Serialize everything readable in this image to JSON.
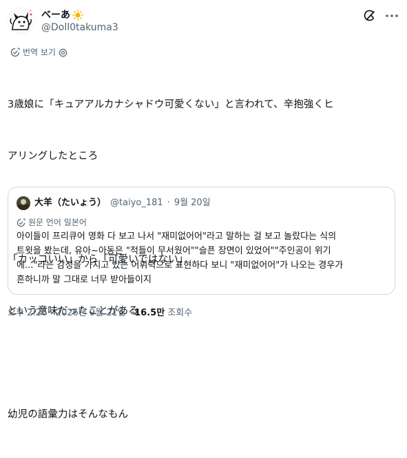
{
  "author": {
    "display_name": "べーあ",
    "handle": "@Doll0takuma3",
    "avatar_icon": "cartoon-character-avatar",
    "name_emoji_icon": "sun-icon"
  },
  "actions": {
    "grok_icon": "grok-icon",
    "more_icon": "more-options-icon"
  },
  "translate": {
    "label": "번역 보기",
    "settings_icon": "gear-icon"
  },
  "tweet": {
    "lines": [
      "3歳娘に「キュアアルカナシャドウ可愛くない」と言われて、辛抱強くヒ",
      "アリングしたところ",
      "",
      "「カッコいい」から「可愛いではない」",
      "という意味だったことがある",
      "",
      "幼児の語彙力はそんなもん"
    ]
  },
  "quote": {
    "display_name": "大羊（たいょう）",
    "handle": "@taiyo_181",
    "separator": "·",
    "date": "9월 20일",
    "original_language_label": "원문 언어 일본어",
    "translate_icon": "translate-icon",
    "lines": [
      "아이들이 프리큐어 영화 다 보고 나서 \"재미없어어\"라고 말하는 걸 보고 놀랐다는 식의",
      "트윗을 봤는데, 유아~아동은 \"적들이 무서웠어\"\"슬픈 장면이 있었어\"\"주인공이 위기",
      "에...\"라는 감정을 가지고 있는 어휘력으로 표현하다 보니 \"재미없어어\"가 나오는 경우가",
      "흔하니까 말 그대로 너무 받아들이지"
    ]
  },
  "meta": {
    "time": "오후 2:26",
    "separator": "·",
    "date": "2026년 9월 21일",
    "views_count": "16.5만",
    "views_label": "조회수"
  },
  "colors": {
    "text_primary": "#0f1419",
    "text_secondary": "#536471",
    "border": "#cfd9de",
    "sun": "#ffb300"
  }
}
